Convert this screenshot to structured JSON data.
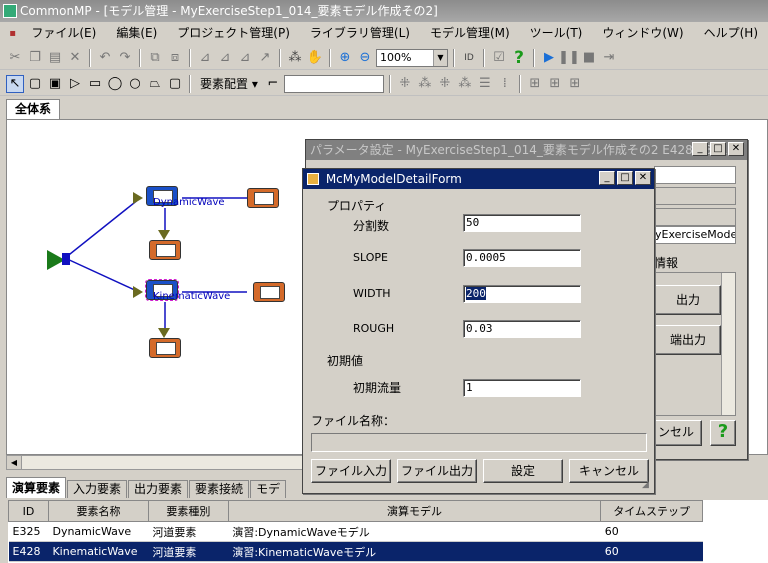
{
  "app": {
    "title": "CommonMP - [モデル管理 - MyExerciseStep1_014_要素モデル作成その2]"
  },
  "menu": [
    "ファイル(E)",
    "編集(E)",
    "プロジェクト管理(P)",
    "ライブラリ管理(L)",
    "モデル管理(M)",
    "ツール(T)",
    "ウィンドウ(W)",
    "ヘルプ(H)"
  ],
  "toolbar": {
    "zoom": "100%",
    "placement": "要素配置"
  },
  "tab": {
    "main": "全体系"
  },
  "canvas": {
    "labels": {
      "top": "DynamicWave",
      "mid": "KinematicWave"
    },
    "node_labels": {
      "out": "出力"
    }
  },
  "param_window": {
    "title": "パラメータ設定 - MyExerciseStep1_014_要素モデル作成その2 E428-13510",
    "side_text": "yExerciseMode",
    "info": "情報",
    "out1": "出力",
    "out2": "端出力",
    "cancel": "ンセル",
    "help": "?"
  },
  "form": {
    "title": "McMyModelDetailForm",
    "section1": "プロパティ",
    "params": [
      {
        "label": "分割数",
        "value": "50"
      },
      {
        "label": "SLOPE",
        "value": "0.0005"
      },
      {
        "label": "WIDTH",
        "value": "200"
      },
      {
        "label": "ROUGH",
        "value": "0.03"
      }
    ],
    "section2": "初期値",
    "init": {
      "label": "初期流量",
      "value": "1"
    },
    "file_label": "ファイル名称：",
    "buttons": {
      "file_in": "ファイル入力",
      "file_out": "ファイル出力",
      "settings": "設定",
      "cancel": "キャンセル"
    }
  },
  "bottom_tabs": [
    "演算要素",
    "入力要素",
    "出力要素",
    "要素接続",
    "モデ"
  ],
  "grid": {
    "headers": [
      "ID",
      "要素名称",
      "要素種別",
      "演算モデル",
      "タイムステップ"
    ],
    "rows": [
      [
        "E325",
        "DynamicWave",
        "河道要素",
        "演習:DynamicWaveモデル",
        "60"
      ],
      [
        "E428",
        "KinematicWave",
        "河道要素",
        "演習:KinematicWaveモデル",
        "60"
      ]
    ]
  },
  "colors": {
    "selection": "#0a246a",
    "title_active": "#0a246a",
    "node_out": "#d46a2a",
    "node_model": "#1a50c8"
  }
}
